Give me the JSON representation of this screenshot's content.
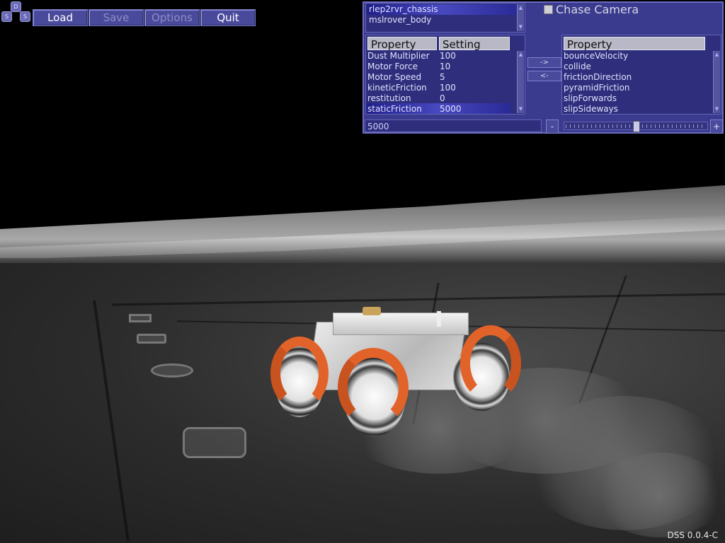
{
  "menu": {
    "load": "Load",
    "save": "Save",
    "options": "Options",
    "quit": "Quit"
  },
  "logo": {
    "top": "D",
    "left": "S",
    "right": "S"
  },
  "objects_list": [
    "rlep2rvr_chassis",
    "mslrover_body"
  ],
  "chase_camera": {
    "label": "Chase Camera",
    "checked": false
  },
  "properties_table": {
    "col_property": "Property",
    "col_setting": "Setting",
    "rows": [
      {
        "property": "Dust Multiplier",
        "setting": "100"
      },
      {
        "property": "Motor Force",
        "setting": "10"
      },
      {
        "property": "Motor Speed",
        "setting": "5"
      },
      {
        "property": "kineticFriction",
        "setting": "100"
      },
      {
        "property": "restitution",
        "setting": "0"
      },
      {
        "property": "staticFriction",
        "setting": "5000"
      }
    ],
    "selected_row": 5
  },
  "transfer": {
    "add": "->",
    "remove": "<-"
  },
  "available_properties": {
    "header": "Property",
    "items": [
      "bounceVelocity",
      "collide",
      "frictionDirection",
      "pyramidFriction",
      "slipForwards",
      "slipSideways"
    ]
  },
  "value_input": "5000",
  "slider": {
    "minus": "-",
    "plus": "+",
    "level": 0.5
  },
  "version": "DSS 0.0.4-C"
}
